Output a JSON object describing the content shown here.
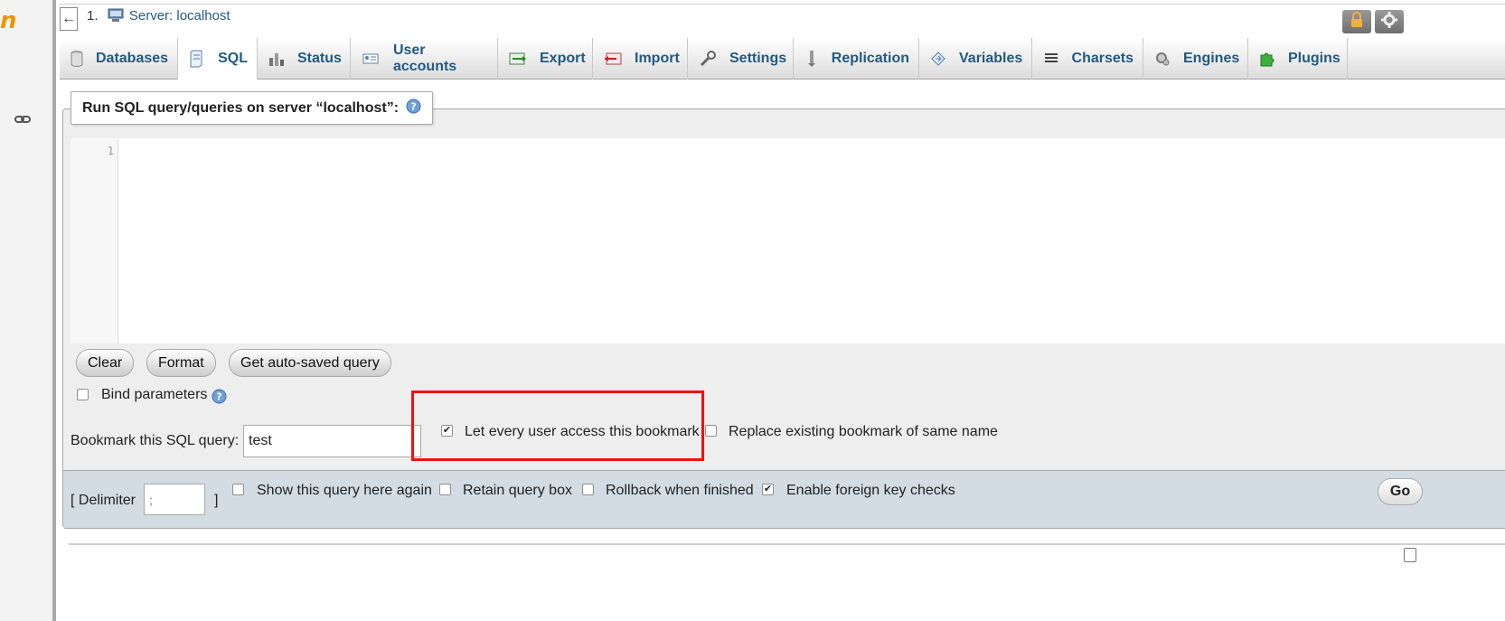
{
  "nav": {
    "logo_fragment": "n"
  },
  "topbar": {
    "collapse_glyph": "←",
    "breadcrumb_index": "1.",
    "server_label": "Server: localhost"
  },
  "tabs": [
    {
      "label": "Databases",
      "icon": "database-icon"
    },
    {
      "label": "SQL",
      "icon": "sql-icon",
      "active": true
    },
    {
      "label": "Status",
      "icon": "status-icon"
    },
    {
      "label": "User accounts",
      "icon": "user-accounts-icon"
    },
    {
      "label": "Export",
      "icon": "export-icon"
    },
    {
      "label": "Import",
      "icon": "import-icon"
    },
    {
      "label": "Settings",
      "icon": "wrench-icon"
    },
    {
      "label": "Replication",
      "icon": "replication-icon"
    },
    {
      "label": "Variables",
      "icon": "variables-icon"
    },
    {
      "label": "Charsets",
      "icon": "charsets-icon"
    },
    {
      "label": "Engines",
      "icon": "engines-icon"
    },
    {
      "label": "Plugins",
      "icon": "puzzle-icon"
    }
  ],
  "query_form": {
    "legend": "Run SQL query/queries on server “localhost”:",
    "editor_line_number": "1",
    "buttons": {
      "clear": "Clear",
      "format": "Format",
      "autosaved": "Get auto-saved query"
    },
    "bind_parameters": {
      "label": "Bind parameters",
      "checked": false
    },
    "bookmark": {
      "label": "Bookmark this SQL query:",
      "value": "test",
      "share_label": "Let every user access this bookmark",
      "share_checked": true,
      "replace_label": "Replace existing bookmark of same name",
      "replace_checked": false
    }
  },
  "options_bar": {
    "delimiter_label": "[ Delimiter",
    "delimiter_close": "]",
    "delimiter_placeholder": ";",
    "show_query_label": "Show this query here again",
    "retain_label": "Retain query box",
    "rollback_label": "Rollback when finished",
    "foreign_key_label": "Enable foreign key checks",
    "foreign_key_checked": true,
    "go_label": "Go"
  },
  "colors": {
    "tab_text": "#235a81",
    "highlight": "#ee1111",
    "bottom_bar": "#d3dce3"
  }
}
